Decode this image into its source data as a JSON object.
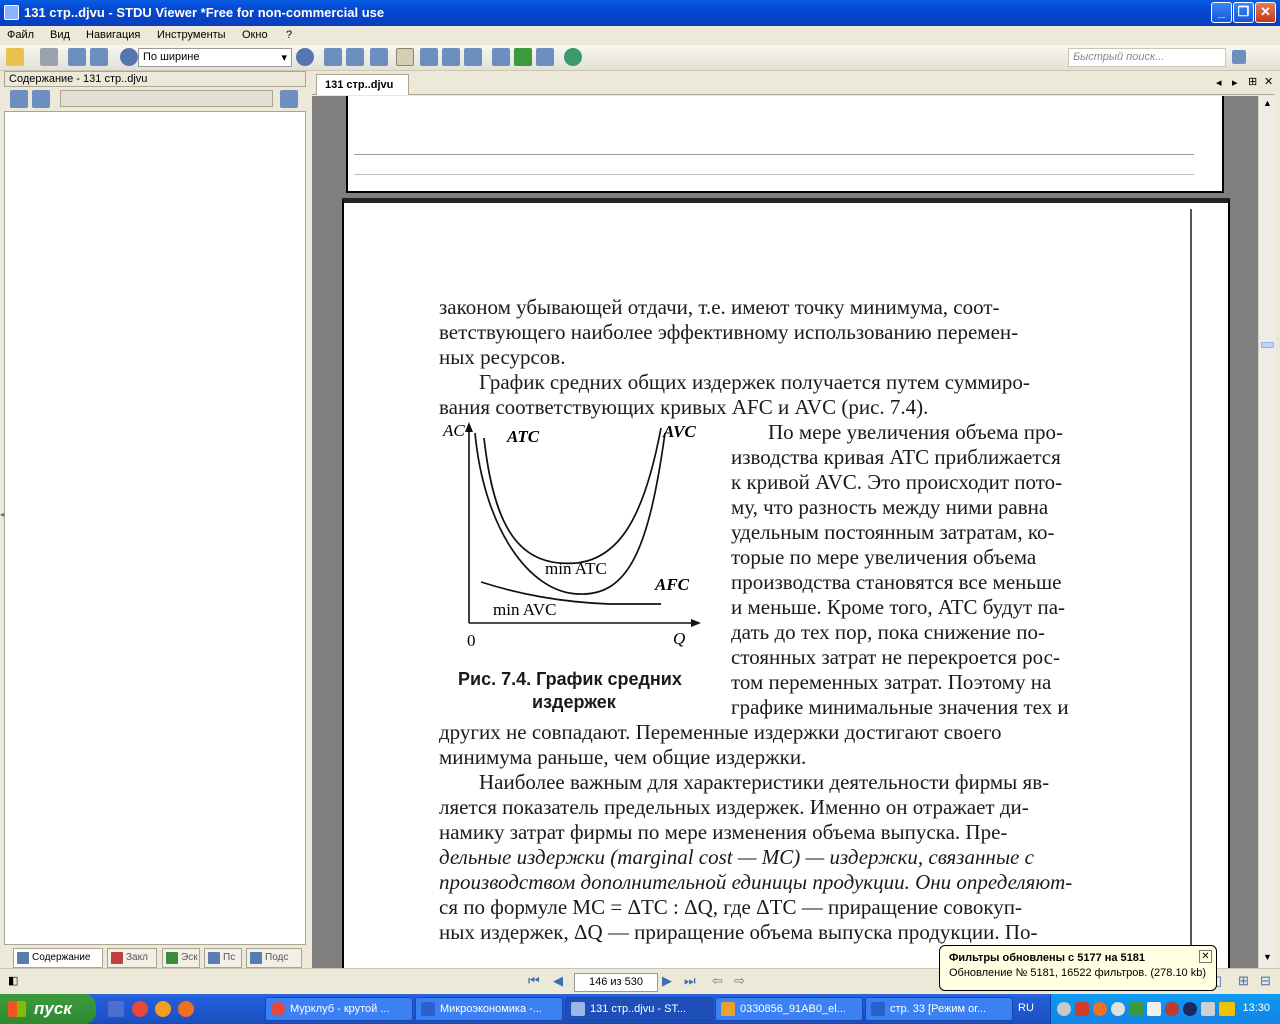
{
  "window": {
    "title": "131 стр..djvu - STDU Viewer *Free for non-commercial use"
  },
  "menu": [
    "Файл",
    "Вид",
    "Навигация",
    "Инструменты",
    "Окно",
    "?"
  ],
  "toolbar": {
    "zoom_value": "По ширине",
    "search_placeholder": "Быстрый поиск..."
  },
  "sidebar": {
    "header": "Содержание - 131 стр..djvu",
    "tabs": [
      "Содержание",
      "Закл",
      "Эск",
      "Пс",
      "Подс"
    ]
  },
  "document": {
    "tab": "131 стр..djvu",
    "lines": [
      "законом убывающей отдачи, т.е. имеют точку минимума, соот-",
      "ветствующего наиболее эффективному использованию перемен-",
      "ных ресурсов.",
      "График средних общих издержек получается путем суммиро-",
      "вания соответствующих кривых AFC и AVC (рис. 7.4).",
      "По мере увеличения объема про-",
      "изводства кривая ATC приближается",
      "к кривой AVC. Это происходит пото-",
      "му, что разность между ними равна",
      "удельным постоянным затратам, ко-",
      "торые по мере увеличения объема",
      "производства становятся все меньше",
      "и меньше. Кроме того, ATC будут па-",
      "дать до тех пор, пока снижение по-",
      "стоянных затрат не перекроется рос-",
      "том переменных затрат. Поэтому на",
      "графике минимальные значения тех и",
      "других не совпадают. Переменные издержки достигают своего",
      "минимума раньше, чем общие издержки.",
      "Наиболее важным для характеристики деятельности фирмы яв-",
      "ляется показатель предельных издержек. Именно он отражает ди-",
      "намику затрат фирмы по мере изменения объема выпуска. Пре-",
      "дельные издержки (marginal cost — MC) — издержки, связанные с",
      "производством дополнительной единицы продукции. Они определяют-",
      "ся по формуле MC = ΔTC : ΔQ, где ΔTC — приращение совокуп-",
      "ных издержек, ΔQ — приращение объема выпуска продукции. По-"
    ],
    "figure": {
      "y_axis": "AC",
      "x_axis": "Q",
      "origin": "0",
      "labels": [
        "ATC",
        "AVC",
        "AFC",
        "min ATC",
        "min AVC"
      ],
      "caption_line1": "Рис. 7.4. График средних",
      "caption_line2": "издержек"
    }
  },
  "status": {
    "page": "146 из 530"
  },
  "notification": {
    "title": "Фильтры обновлены с 5177 на 5181",
    "body": "Обновление № 5181, 16522 фильтров. (278.10 kb)"
  },
  "taskbar": {
    "start": "пуск",
    "tasks": [
      "Мурклуб - крутой ...",
      "Микроэкономика -...",
      "131 стр..djvu - ST...",
      "0330856_91AB0_el...",
      "стр. 33 [Режим ог..."
    ],
    "lang": "RU",
    "clock": "13:30"
  }
}
